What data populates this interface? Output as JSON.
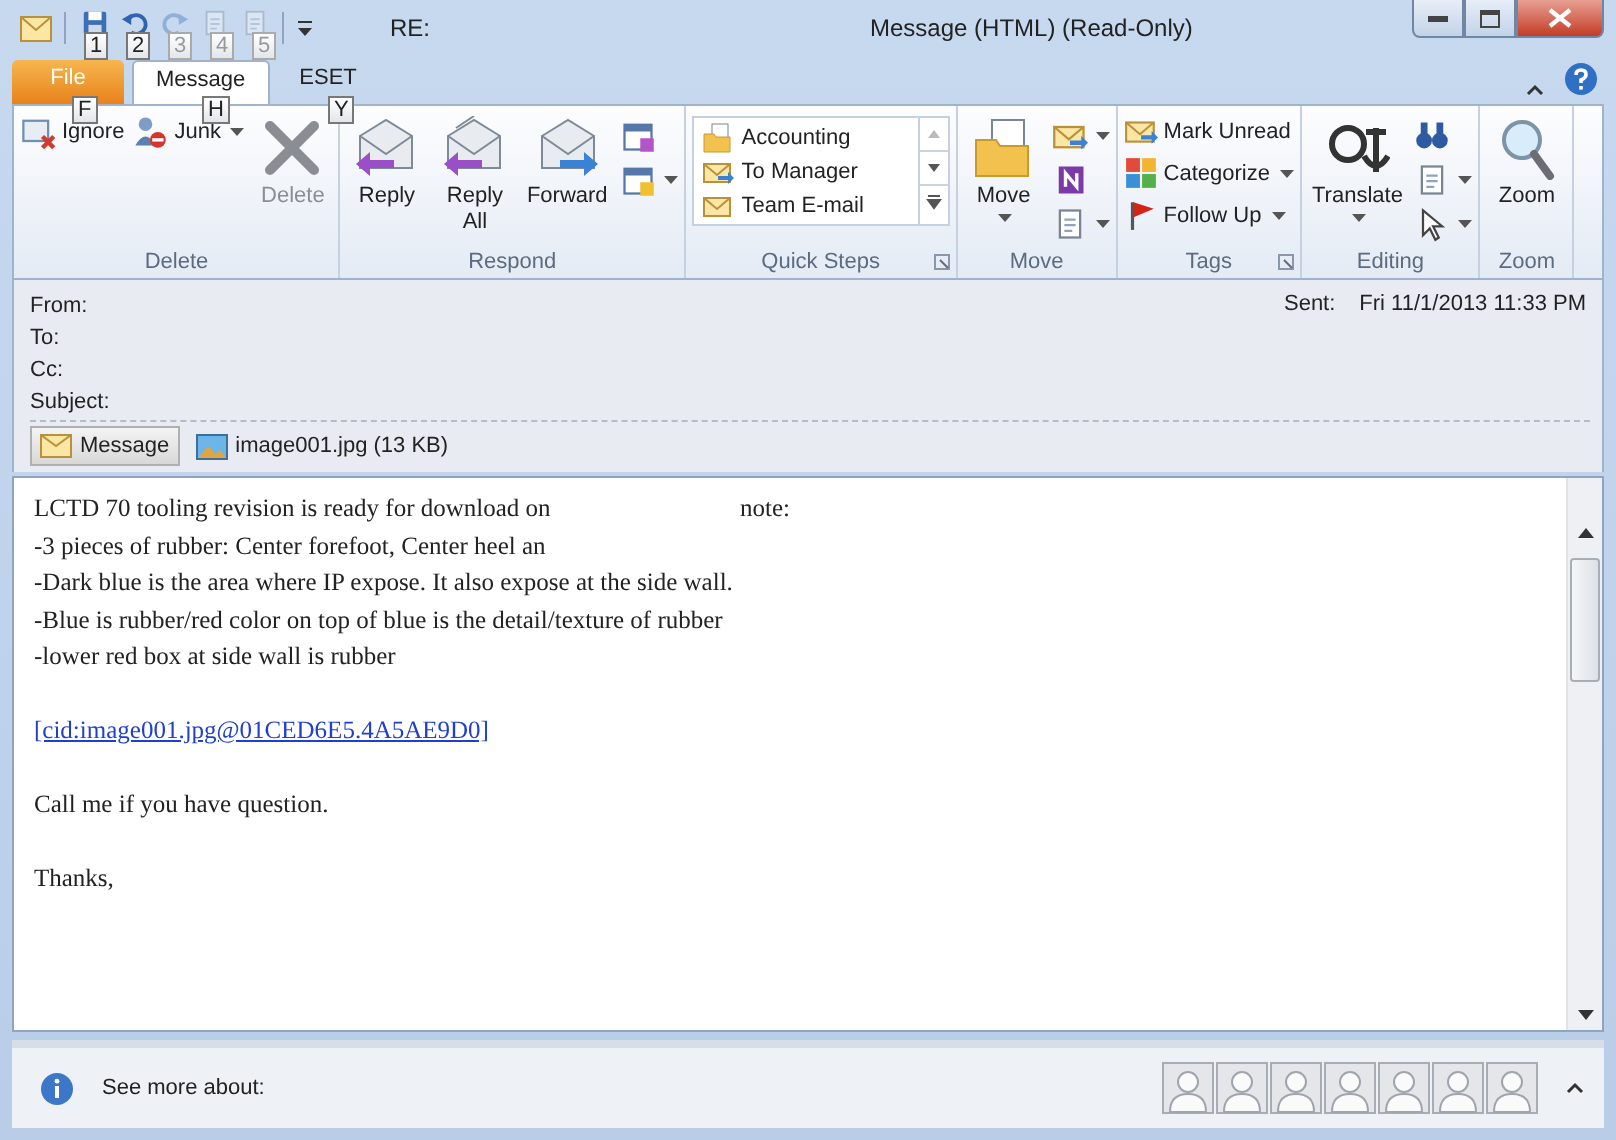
{
  "title_bar": {
    "subject_prefix": "RE:",
    "title": "Message (HTML) (Read-Only)"
  },
  "quick_access": [
    {
      "key_tip": "1",
      "disabled": false
    },
    {
      "key_tip": "2",
      "disabled": false
    },
    {
      "key_tip": "3",
      "disabled": true
    },
    {
      "key_tip": "4",
      "disabled": true
    },
    {
      "key_tip": "5",
      "disabled": true
    }
  ],
  "tabs": [
    {
      "label": "File",
      "key_tip": "F",
      "kind": "file",
      "selected": false
    },
    {
      "label": "Message",
      "key_tip": "H",
      "kind": "tab",
      "selected": true
    },
    {
      "label": "ESET",
      "key_tip": "Y",
      "kind": "tab",
      "selected": false
    }
  ],
  "ribbon": [
    {
      "name": "Delete",
      "items": [
        {
          "kind": "small",
          "label": "Ignore",
          "dropdown": false,
          "disabled": false
        },
        {
          "kind": "small",
          "label": "Junk",
          "dropdown": true,
          "disabled": false
        },
        {
          "kind": "large",
          "label": "Delete",
          "dropdown": false,
          "disabled": true
        }
      ]
    },
    {
      "name": "Respond",
      "items": [
        {
          "kind": "large",
          "label": "Reply",
          "dropdown": false,
          "disabled": false
        },
        {
          "kind": "large",
          "label": "Reply All",
          "dropdown": false,
          "disabled": false
        },
        {
          "kind": "large",
          "label": "Forward",
          "dropdown": false,
          "disabled": false
        },
        {
          "kind": "stack",
          "items": [
            {
              "dropdown": false
            },
            {
              "dropdown": true
            }
          ]
        }
      ]
    },
    {
      "name": "Quick Steps",
      "items": [
        {
          "kind": "gallery",
          "entries": [
            "Accounting",
            "To Manager",
            "Team E-mail"
          ]
        }
      ],
      "launcher": true
    },
    {
      "name": "Move",
      "items": [
        {
          "kind": "large",
          "label": "Move",
          "dropdown": true,
          "disabled": false
        },
        {
          "kind": "stack",
          "items": [
            {
              "dropdown": true
            },
            {
              "dropdown": false
            },
            {
              "dropdown": true
            }
          ]
        }
      ]
    },
    {
      "name": "Tags",
      "items": [
        {
          "kind": "column",
          "entries": [
            {
              "label": "Mark Unread",
              "dropdown": false
            },
            {
              "label": "Categorize",
              "dropdown": true
            },
            {
              "label": "Follow Up",
              "dropdown": true
            }
          ]
        }
      ],
      "launcher": true
    },
    {
      "name": "Editing",
      "items": [
        {
          "kind": "large",
          "label": "Translate",
          "dropdown": true,
          "disabled": false
        },
        {
          "kind": "stack",
          "items": [
            {
              "dropdown": false
            },
            {
              "dropdown": true
            },
            {
              "dropdown": true
            }
          ]
        }
      ]
    },
    {
      "name": "Zoom",
      "items": [
        {
          "kind": "large",
          "label": "Zoom",
          "dropdown": false,
          "disabled": false
        }
      ]
    }
  ],
  "header": {
    "fields": [
      "From:",
      "To:",
      "Cc:",
      "Subject:"
    ],
    "sent_label": "Sent:",
    "sent_value": "Fri 11/1/2013 11:33 PM"
  },
  "attachments": [
    {
      "label": "Message",
      "selected": true
    },
    {
      "label": "image001.jpg (13 KB)",
      "selected": false
    }
  ],
  "body": [
    {
      "kind": "text",
      "lines": [
        {
          "text": "LCTD 70 tooling revision is ready for download on",
          "tail": "note:"
        },
        {
          "text": "-3 pieces of rubber: Center forefoot, Center heel an"
        },
        {
          "text": "-Dark blue is the area where IP expose. It also expose at the side wall."
        },
        {
          "text": "-Blue is rubber/red color on top of blue is the detail/texture of rubber"
        },
        {
          "text": "-lower red box at side wall is rubber"
        }
      ]
    },
    {
      "kind": "link",
      "lines": [
        {
          "text": "[cid:image001.jpg@01CED6E5.4A5AE9D0]"
        }
      ]
    },
    {
      "kind": "text",
      "lines": [
        {
          "text": "Call me if you have question."
        }
      ]
    },
    {
      "kind": "text",
      "lines": [
        {
          "text": "Thanks,"
        }
      ]
    }
  ],
  "people_pane": {
    "label": "See more about:"
  }
}
